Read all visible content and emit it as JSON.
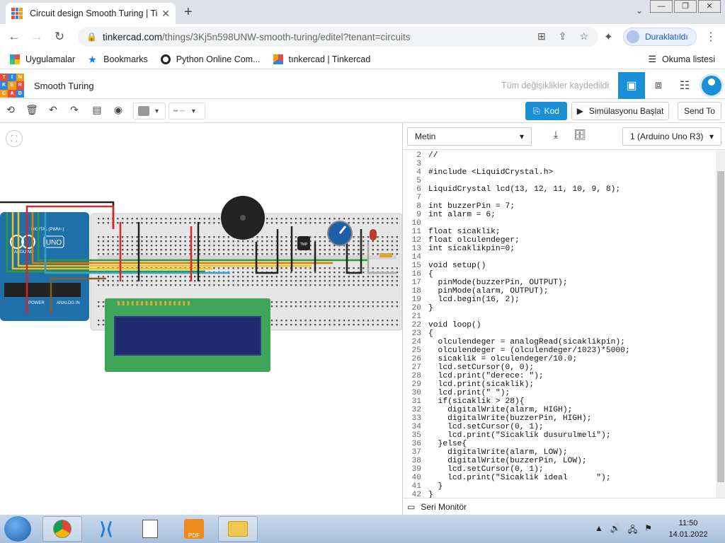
{
  "browser": {
    "tab_title": "Circuit design Smooth Turing | Tinkercad",
    "url_domain": "tinkercad.com",
    "url_path": "/things/3Kj5n598UNW-smooth-turing/editel?tenant=circuits",
    "profile_name": "Duraklatıldı",
    "bookmarks": [
      "Uygulamalar",
      "Bookmarks",
      "Python Online Com...",
      "tınkercad | Tinkercad"
    ],
    "reading_list": "Okuma listesi"
  },
  "tinkercad": {
    "logo_letters": [
      "T",
      "I",
      "N",
      "K",
      "E",
      "R",
      "C",
      "A",
      "D"
    ],
    "project_name": "Smooth Turing",
    "saved_status": "Tüm değişiklikler kaydedildi",
    "code_button": "Kod",
    "simulate_button": "Simülasyonu Başlat",
    "send_button": "Send To"
  },
  "code_panel": {
    "mode": "Metin",
    "device": "1 (Arduino Uno R3)",
    "serial_monitor": "Seri Monitör",
    "lines": [
      {
        "n": "2",
        "t": "//"
      },
      {
        "n": "3",
        "t": ""
      },
      {
        "n": "4",
        "t": "#include <LiquidCrystal.h>"
      },
      {
        "n": "5",
        "t": ""
      },
      {
        "n": "6",
        "t": "LiquidCrystal lcd(13, 12, 11, 10, 9, 8);"
      },
      {
        "n": "7",
        "t": ""
      },
      {
        "n": "8",
        "t": "int buzzerPin = 7;"
      },
      {
        "n": "9",
        "t": "int alarm = 6;"
      },
      {
        "n": "10",
        "t": ""
      },
      {
        "n": "11",
        "t": "float sicaklik;"
      },
      {
        "n": "12",
        "t": "float olculendeger;"
      },
      {
        "n": "13",
        "t": "int sicaklikpin=0;"
      },
      {
        "n": "14",
        "t": ""
      },
      {
        "n": "15",
        "t": "void setup()"
      },
      {
        "n": "16",
        "t": "{"
      },
      {
        "n": "17",
        "t": "  pinMode(buzzerPin, OUTPUT);"
      },
      {
        "n": "18",
        "t": "  pinMode(alarm, OUTPUT);"
      },
      {
        "n": "19",
        "t": "  lcd.begin(16, 2);"
      },
      {
        "n": "20",
        "t": "}"
      },
      {
        "n": "21",
        "t": ""
      },
      {
        "n": "22",
        "t": "void loop()"
      },
      {
        "n": "23",
        "t": "{"
      },
      {
        "n": "24",
        "t": "  olculendeger = analogRead(sicaklikpin);"
      },
      {
        "n": "25",
        "t": "  olculendeger = (olculendeger/1023)*5000;"
      },
      {
        "n": "26",
        "t": "  sicaklik = olculendeger/10.0;"
      },
      {
        "n": "27",
        "t": "  lcd.setCursor(0, 0);"
      },
      {
        "n": "28",
        "t": "  lcd.print(\"derece: \");"
      },
      {
        "n": "29",
        "t": "  lcd.print(sicaklik);"
      },
      {
        "n": "30",
        "t": "  lcd.print(\" \");"
      },
      {
        "n": "31",
        "t": "  if(sicaklik > 28){"
      },
      {
        "n": "32",
        "t": "    digitalWrite(alarm, HIGH);"
      },
      {
        "n": "33",
        "t": "    digitalWrite(buzzerPin, HIGH);"
      },
      {
        "n": "34",
        "t": "    lcd.setCursor(0, 1);"
      },
      {
        "n": "35",
        "t": "    lcd.print(\"Sicaklik dusurulmeli\");"
      },
      {
        "n": "36",
        "t": "  }else{"
      },
      {
        "n": "37",
        "t": "    digitalWrite(alarm, LOW);"
      },
      {
        "n": "38",
        "t": "    digitalWrite(buzzerPin, LOW);"
      },
      {
        "n": "39",
        "t": "    lcd.setCursor(0, 1);"
      },
      {
        "n": "40",
        "t": "    lcd.print(\"Sicaklik ideal      \");"
      },
      {
        "n": "41",
        "t": "  }"
      },
      {
        "n": "42",
        "t": "}"
      }
    ]
  },
  "circuit": {
    "arduino_labels": [
      "UNO",
      "ARDUINO",
      "DIGITAL (PWM~)",
      "POWER",
      "ANALOG IN"
    ],
    "sensor_label": "TMP"
  },
  "taskbar": {
    "time": "11:50",
    "date": "14.01.2022",
    "pdf_label": "PDF"
  },
  "colors": {
    "accent": "#1a8fd6",
    "breadboard": "#e8e8e8",
    "arduino": "#1f6fa8",
    "lcd_board": "#3fa558",
    "lcd_screen": "#1e2a6b"
  }
}
